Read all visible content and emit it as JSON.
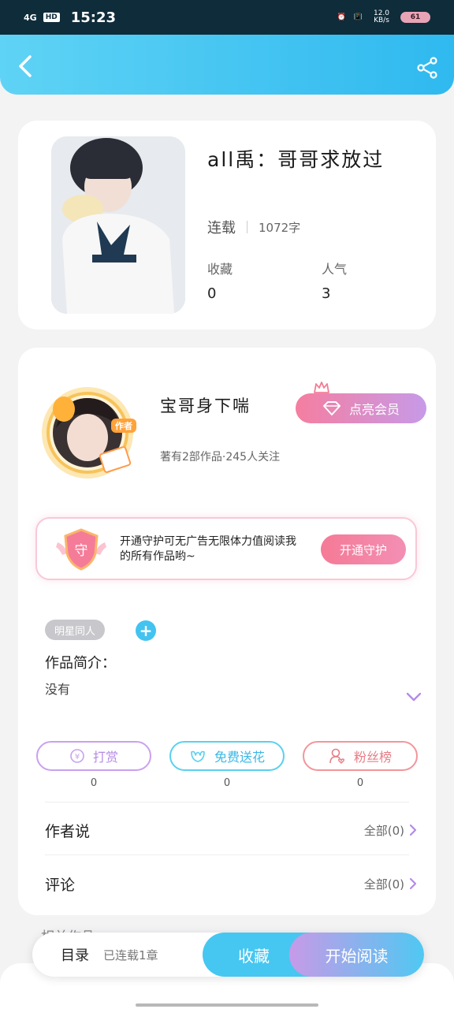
{
  "status_bar": {
    "network": "4G",
    "hd": "HD",
    "time": "15:23",
    "net_speed": "12.0 KB/s",
    "battery": "61"
  },
  "book": {
    "title": "all禹：哥哥求放过",
    "status": "连载",
    "word_count": "1072字",
    "favorites_label": "收藏",
    "favorites_value": "0",
    "popularity_label": "人气",
    "popularity_value": "3"
  },
  "author": {
    "badge": "作者",
    "name": "宝哥身下喘",
    "meta": "著有2部作品·245人关注",
    "vip_button": "点亮会员"
  },
  "guard": {
    "icon_char": "守",
    "text": "开通守护可无广告无限体力值阅读我的所有作品哟~",
    "button": "开通守护"
  },
  "tags": [
    "明星同人"
  ],
  "intro": {
    "title": "作品简介：",
    "text": "没有"
  },
  "actions": [
    {
      "label": "打赏",
      "count": "0",
      "icon": "coin-icon"
    },
    {
      "label": "免费送花",
      "count": "0",
      "icon": "flower-icon"
    },
    {
      "label": "粉丝榜",
      "count": "0",
      "icon": "fans-icon"
    }
  ],
  "author_says": {
    "title": "作者说",
    "link": "全部(0)"
  },
  "comments": {
    "title": "评论",
    "link": "全部(0)"
  },
  "peek_text": "相关作品",
  "bottom_bar": {
    "toc_label": "目录",
    "toc_status": "已连载1章",
    "collect": "收藏",
    "read": "开始阅读"
  },
  "colors": {
    "header": "#2fb9ef",
    "accent_blue": "#46c7f1",
    "accent_purple": "#c79ae8",
    "accent_pink": "#f57ea0"
  }
}
